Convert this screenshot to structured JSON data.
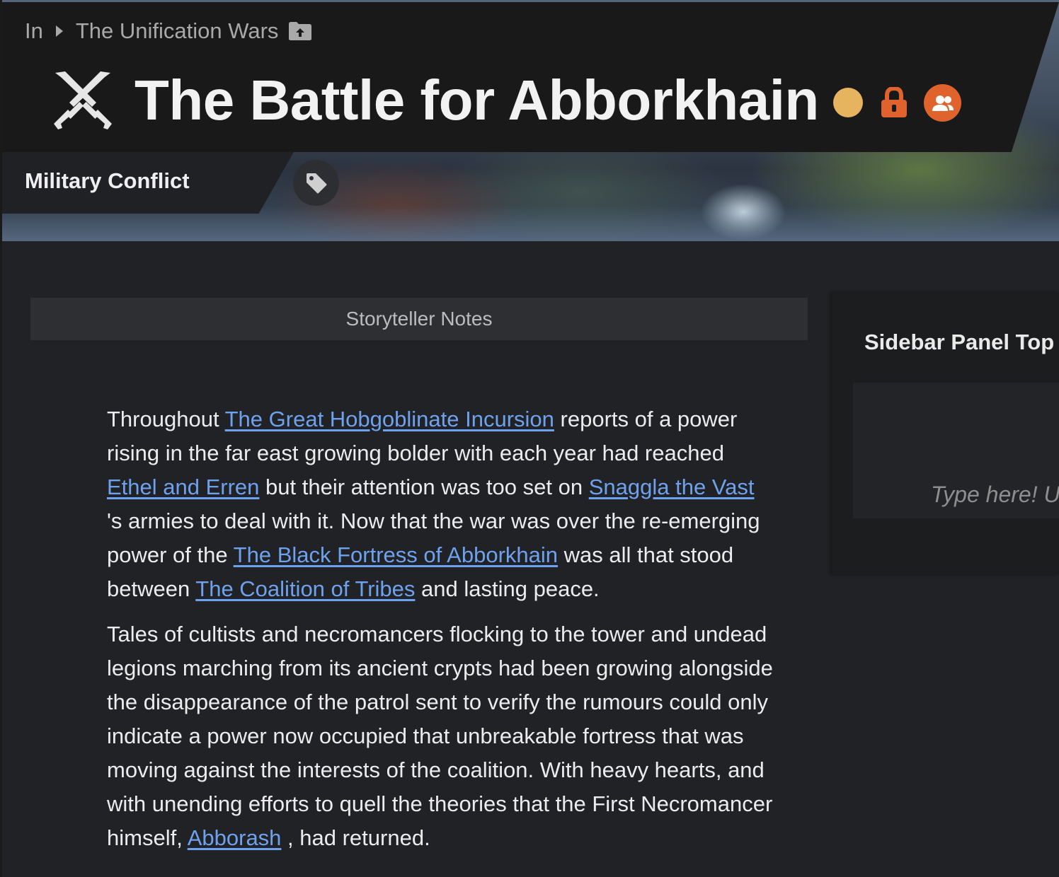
{
  "breadcrumb": {
    "prefix": "In",
    "parent": "The Unification Wars",
    "parent_icon": "folder-up-icon"
  },
  "header": {
    "title": "The Battle for Abborkhain",
    "icon": "crossed-swords-icon",
    "status_color": "#e6b45e",
    "accent_color": "#e0622c"
  },
  "category": {
    "label": "Military Conflict",
    "tag_icon": "tag-icon"
  },
  "notes": {
    "label": "Storyteller Notes"
  },
  "article": {
    "p1": {
      "t1": "Throughout ",
      "l1": "The Great Hobgoblinate Incursion",
      "t2": "  reports of a power rising in the far east growing bolder with each year had reached ",
      "l2": "Ethel and Erren",
      "t3": "  but their attention was too set on ",
      "l3": "Snaggla the Vast",
      "t4": " 's armies to deal with it. Now that the war was over the re-emerging power of the ",
      "l4": "The Black Fortress of Abborkhain",
      "t5": "  was all that stood between ",
      "l5": "The Coalition of Tribes",
      "t6": " and lasting peace."
    },
    "p2": {
      "t1": "Tales of cultists and necromancers flocking to the tower and undead legions marching from its ancient crypts had been growing alongside the disappearance of the patrol sent to verify the rumours could only indicate a power now occupied that unbreakable fortress that was moving against the interests of the coalition. With heavy hearts, and with unending efforts to quell the theories that the First Necromancer himself, ",
      "l1": "Abborash",
      "t2": " , had returned."
    },
    "link_color": "#6ea2ee"
  },
  "sidebar": {
    "title": "Sidebar Panel Top",
    "placeholder": "Type here! Use"
  }
}
